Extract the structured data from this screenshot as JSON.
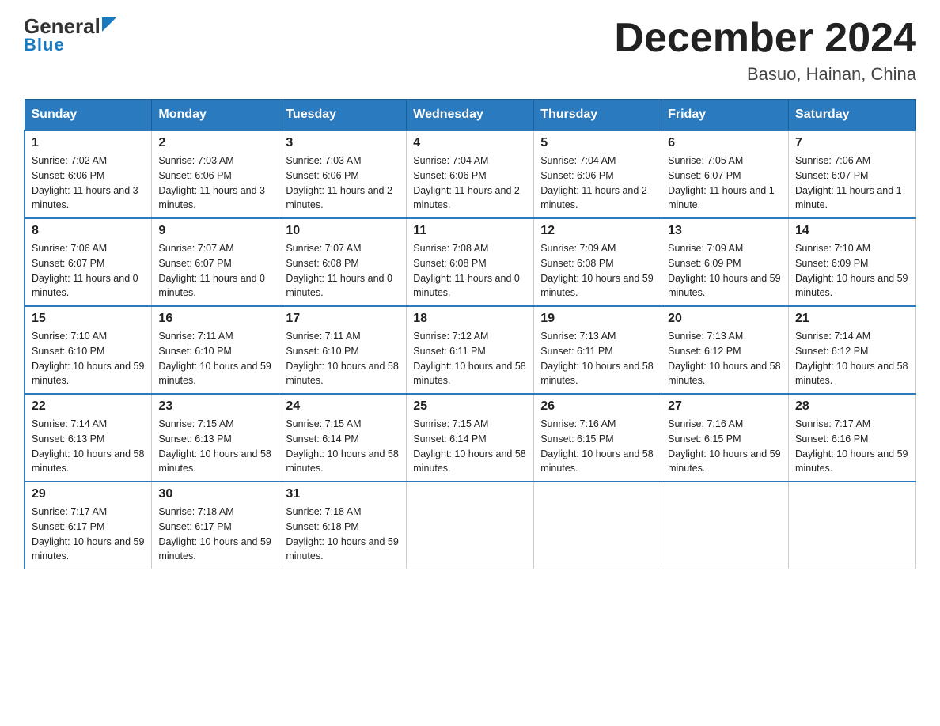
{
  "logo": {
    "text1": "General",
    "text2": "Blue"
  },
  "title": "December 2024",
  "subtitle": "Basuo, Hainan, China",
  "days_of_week": [
    "Sunday",
    "Monday",
    "Tuesday",
    "Wednesday",
    "Thursday",
    "Friday",
    "Saturday"
  ],
  "weeks": [
    [
      {
        "day": "1",
        "sunrise": "7:02 AM",
        "sunset": "6:06 PM",
        "daylight": "11 hours and 3 minutes."
      },
      {
        "day": "2",
        "sunrise": "7:03 AM",
        "sunset": "6:06 PM",
        "daylight": "11 hours and 3 minutes."
      },
      {
        "day": "3",
        "sunrise": "7:03 AM",
        "sunset": "6:06 PM",
        "daylight": "11 hours and 2 minutes."
      },
      {
        "day": "4",
        "sunrise": "7:04 AM",
        "sunset": "6:06 PM",
        "daylight": "11 hours and 2 minutes."
      },
      {
        "day": "5",
        "sunrise": "7:04 AM",
        "sunset": "6:06 PM",
        "daylight": "11 hours and 2 minutes."
      },
      {
        "day": "6",
        "sunrise": "7:05 AM",
        "sunset": "6:07 PM",
        "daylight": "11 hours and 1 minute."
      },
      {
        "day": "7",
        "sunrise": "7:06 AM",
        "sunset": "6:07 PM",
        "daylight": "11 hours and 1 minute."
      }
    ],
    [
      {
        "day": "8",
        "sunrise": "7:06 AM",
        "sunset": "6:07 PM",
        "daylight": "11 hours and 0 minutes."
      },
      {
        "day": "9",
        "sunrise": "7:07 AM",
        "sunset": "6:07 PM",
        "daylight": "11 hours and 0 minutes."
      },
      {
        "day": "10",
        "sunrise": "7:07 AM",
        "sunset": "6:08 PM",
        "daylight": "11 hours and 0 minutes."
      },
      {
        "day": "11",
        "sunrise": "7:08 AM",
        "sunset": "6:08 PM",
        "daylight": "11 hours and 0 minutes."
      },
      {
        "day": "12",
        "sunrise": "7:09 AM",
        "sunset": "6:08 PM",
        "daylight": "10 hours and 59 minutes."
      },
      {
        "day": "13",
        "sunrise": "7:09 AM",
        "sunset": "6:09 PM",
        "daylight": "10 hours and 59 minutes."
      },
      {
        "day": "14",
        "sunrise": "7:10 AM",
        "sunset": "6:09 PM",
        "daylight": "10 hours and 59 minutes."
      }
    ],
    [
      {
        "day": "15",
        "sunrise": "7:10 AM",
        "sunset": "6:10 PM",
        "daylight": "10 hours and 59 minutes."
      },
      {
        "day": "16",
        "sunrise": "7:11 AM",
        "sunset": "6:10 PM",
        "daylight": "10 hours and 59 minutes."
      },
      {
        "day": "17",
        "sunrise": "7:11 AM",
        "sunset": "6:10 PM",
        "daylight": "10 hours and 58 minutes."
      },
      {
        "day": "18",
        "sunrise": "7:12 AM",
        "sunset": "6:11 PM",
        "daylight": "10 hours and 58 minutes."
      },
      {
        "day": "19",
        "sunrise": "7:13 AM",
        "sunset": "6:11 PM",
        "daylight": "10 hours and 58 minutes."
      },
      {
        "day": "20",
        "sunrise": "7:13 AM",
        "sunset": "6:12 PM",
        "daylight": "10 hours and 58 minutes."
      },
      {
        "day": "21",
        "sunrise": "7:14 AM",
        "sunset": "6:12 PM",
        "daylight": "10 hours and 58 minutes."
      }
    ],
    [
      {
        "day": "22",
        "sunrise": "7:14 AM",
        "sunset": "6:13 PM",
        "daylight": "10 hours and 58 minutes."
      },
      {
        "day": "23",
        "sunrise": "7:15 AM",
        "sunset": "6:13 PM",
        "daylight": "10 hours and 58 minutes."
      },
      {
        "day": "24",
        "sunrise": "7:15 AM",
        "sunset": "6:14 PM",
        "daylight": "10 hours and 58 minutes."
      },
      {
        "day": "25",
        "sunrise": "7:15 AM",
        "sunset": "6:14 PM",
        "daylight": "10 hours and 58 minutes."
      },
      {
        "day": "26",
        "sunrise": "7:16 AM",
        "sunset": "6:15 PM",
        "daylight": "10 hours and 58 minutes."
      },
      {
        "day": "27",
        "sunrise": "7:16 AM",
        "sunset": "6:15 PM",
        "daylight": "10 hours and 59 minutes."
      },
      {
        "day": "28",
        "sunrise": "7:17 AM",
        "sunset": "6:16 PM",
        "daylight": "10 hours and 59 minutes."
      }
    ],
    [
      {
        "day": "29",
        "sunrise": "7:17 AM",
        "sunset": "6:17 PM",
        "daylight": "10 hours and 59 minutes."
      },
      {
        "day": "30",
        "sunrise": "7:18 AM",
        "sunset": "6:17 PM",
        "daylight": "10 hours and 59 minutes."
      },
      {
        "day": "31",
        "sunrise": "7:18 AM",
        "sunset": "6:18 PM",
        "daylight": "10 hours and 59 minutes."
      },
      null,
      null,
      null,
      null
    ]
  ]
}
